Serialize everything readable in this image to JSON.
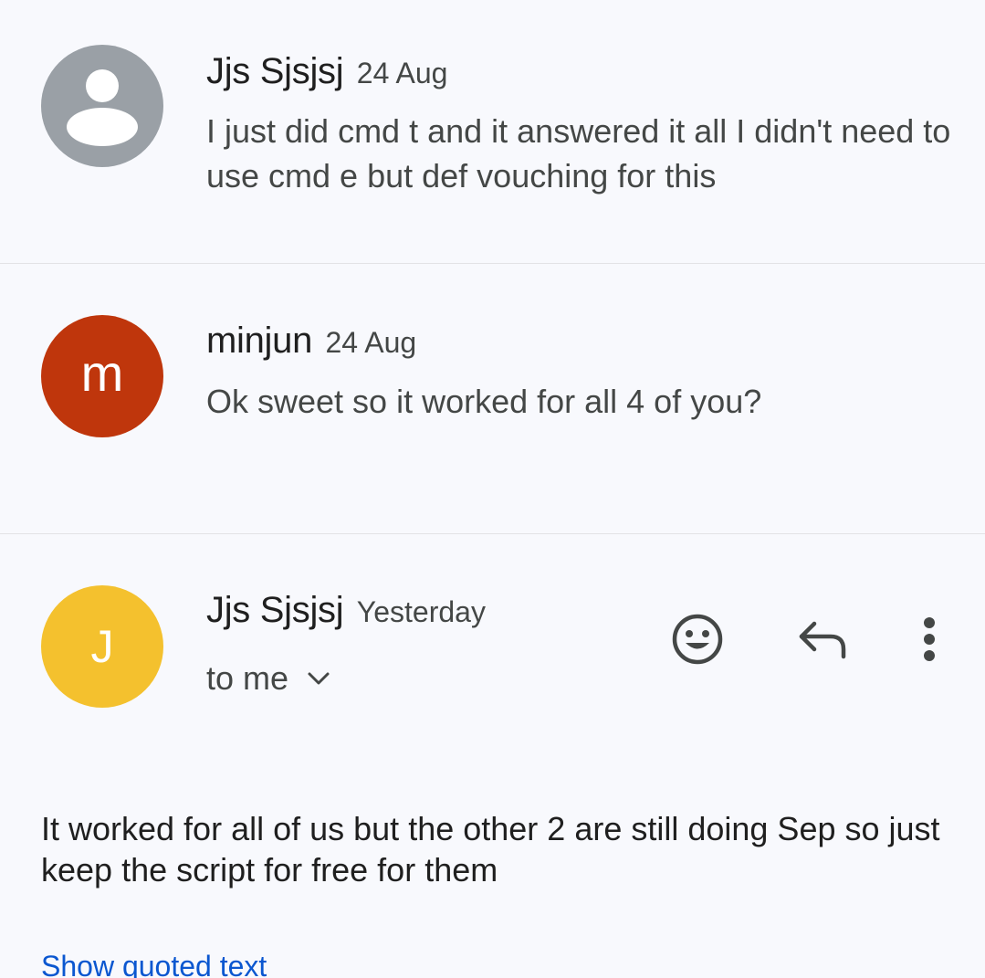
{
  "messages": [
    {
      "sender": "Jjs Sjsjsj",
      "date": "24 Aug",
      "snippet": "I just did cmd t and it answered it all I didn't need to use cmd e but def vouching for this",
      "avatar_type": "person-icon",
      "avatar_color": "#9aa0a6"
    },
    {
      "sender": "minjun",
      "date": "24 Aug",
      "snippet": "Ok sweet so it worked for all 4 of you?",
      "avatar_letter": "m",
      "avatar_color": "#bf360c"
    }
  ],
  "open_message": {
    "sender": "Jjs Sjsjsj",
    "date": "Yesterday",
    "recipient": "to me",
    "avatar_letter": "J",
    "avatar_color": "#f4c12e",
    "body": "It worked for all of us but the other 2 are still doing Sep so just keep the script for free for them",
    "show_quoted": "Show quoted text",
    "actions": [
      "emoji-reaction-icon",
      "reply-icon",
      "more-vert-icon"
    ]
  }
}
